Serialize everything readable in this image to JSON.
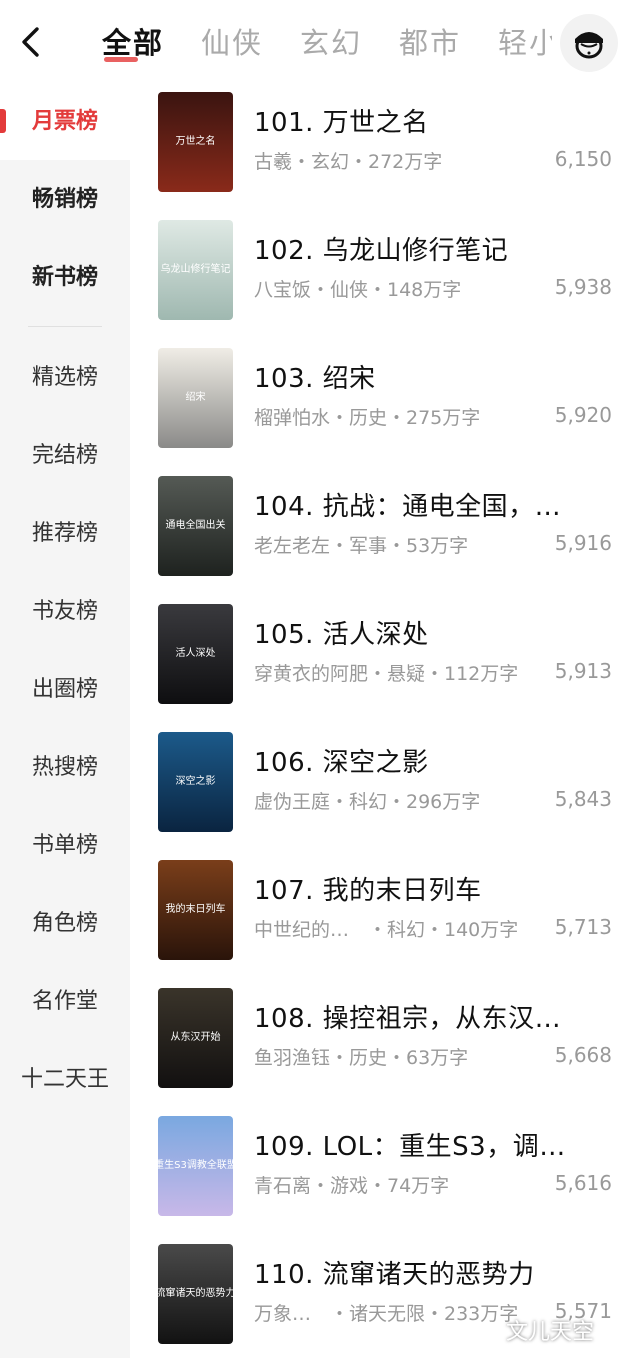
{
  "header": {
    "tabs": [
      {
        "label": "全部",
        "active": true
      },
      {
        "label": "仙侠",
        "active": false
      },
      {
        "label": "玄幻",
        "active": false
      },
      {
        "label": "都市",
        "active": false
      },
      {
        "label": "轻小说",
        "active": false
      }
    ],
    "back_icon": "chevron-left-icon",
    "avatar_icon": "user-avatar-icon"
  },
  "sidebar": {
    "items": [
      {
        "label": "月票榜",
        "active": true
      },
      {
        "label": "畅销榜",
        "active": false
      },
      {
        "label": "新书榜",
        "active": false
      },
      {
        "label": "精选榜",
        "active": false
      },
      {
        "label": "完结榜",
        "active": false
      },
      {
        "label": "推荐榜",
        "active": false
      },
      {
        "label": "书友榜",
        "active": false
      },
      {
        "label": "出圈榜",
        "active": false
      },
      {
        "label": "热搜榜",
        "active": false
      },
      {
        "label": "书单榜",
        "active": false
      },
      {
        "label": "角色榜",
        "active": false
      },
      {
        "label": "名作堂",
        "active": false
      },
      {
        "label": "十二天王",
        "active": false
      }
    ]
  },
  "books": [
    {
      "title": "101. 万世之名",
      "meta": "古羲・玄幻・272万字",
      "count": "6,150",
      "cover_colors": [
        "#3a1410",
        "#8a2a1a"
      ],
      "cover_text": "万世之名"
    },
    {
      "title": "102. 乌龙山修行笔记",
      "meta": "八宝饭・仙侠・148万字",
      "count": "5,938",
      "cover_colors": [
        "#dfe9e4",
        "#9fb8b0"
      ],
      "cover_text": "乌龙山修行笔记"
    },
    {
      "title": "103. 绍宋",
      "meta": "榴弹怕水・历史・275万字",
      "count": "5,920",
      "cover_colors": [
        "#f0ede6",
        "#8a8a88"
      ],
      "cover_text": "绍宋"
    },
    {
      "title": "104. 抗战：通电全国，…",
      "meta": "老左老左・军事・53万字",
      "count": "5,916",
      "cover_colors": [
        "#555a55",
        "#1e221f"
      ],
      "cover_text": "通电全国出关"
    },
    {
      "title": "105. 活人深处",
      "meta": "穿黄衣的阿肥・悬疑・112万字",
      "count": "5,913",
      "cover_colors": [
        "#3a3a3e",
        "#0e0e10"
      ],
      "cover_text": "活人深处"
    },
    {
      "title": "106. 深空之影",
      "meta": "虚伪王庭・科幻・296万字",
      "count": "5,843",
      "cover_colors": [
        "#1c5a8a",
        "#0a2440"
      ],
      "cover_text": "深空之影"
    },
    {
      "title": "107. 我的末日列车",
      "meta": "中世纪的…　・科幻・140万字",
      "count": "5,713",
      "cover_colors": [
        "#7a3e1a",
        "#2a140a"
      ],
      "cover_text": "我的末日列车"
    },
    {
      "title": "108. 操控祖宗，从东汉…",
      "meta": "鱼羽渔钰・历史・63万字",
      "count": "5,668",
      "cover_colors": [
        "#3a342a",
        "#121010"
      ],
      "cover_text": "从东汉开始"
    },
    {
      "title": "109. LOL：重生S3，调…",
      "meta": "青石离・游戏・74万字",
      "count": "5,616",
      "cover_colors": [
        "#7aa8e0",
        "#c8b8e8"
      ],
      "cover_text": "重生S3调教全联盟"
    },
    {
      "title": "110. 流窜诸天的恶势力",
      "meta": "万象…　・诸天无限・233万字",
      "count": "5,571",
      "cover_colors": [
        "#4a4a4a",
        "#121212"
      ],
      "cover_text": "流窜诸天的恶势力"
    }
  ],
  "watermark": "文儿天空"
}
